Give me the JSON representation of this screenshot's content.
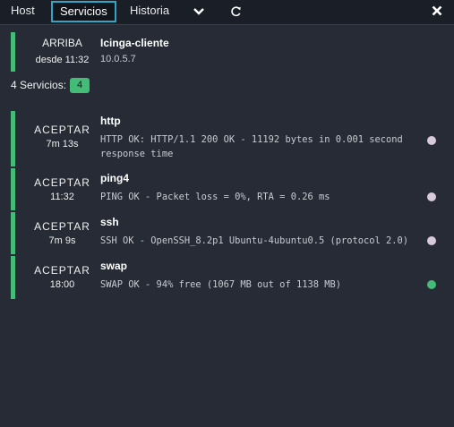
{
  "tabs": {
    "host": "Host",
    "servicios": "Servicios",
    "historia": "Historia"
  },
  "icons": {
    "chevron": "chevron-down-icon",
    "refresh": "refresh-icon",
    "close": "close-icon"
  },
  "host": {
    "state": "ARRIBA",
    "since": "desde 11:32",
    "name": "Icinga-cliente",
    "address": "10.0.5.7"
  },
  "services_summary": {
    "label": "4 Servicios:",
    "count": "4"
  },
  "services": [
    {
      "state": "ACEPTAR",
      "time": "7m 13s",
      "name": "http",
      "output": "HTTP OK: HTTP/1.1 200 OK - 11192 bytes in 0.001 second response time"
    },
    {
      "state": "ACEPTAR",
      "time": "11:32",
      "name": "ping4",
      "output": "PING OK - Packet loss = 0%, RTA = 0.26 ms"
    },
    {
      "state": "ACEPTAR",
      "time": "7m 9s",
      "name": "ssh",
      "output": "SSH OK - OpenSSH_8.2p1 Ubuntu-4ubuntu0.5 (protocol 2.0)"
    },
    {
      "state": "ACEPTAR",
      "time": "18:00",
      "name": "swap",
      "output": "SWAP OK - 94% free (1067 MB out of 1138 MB)"
    }
  ],
  "colors": {
    "ok": "#44bb77",
    "accent": "#33a4c1",
    "background": "#262b35",
    "dot": "#d8cad8"
  }
}
